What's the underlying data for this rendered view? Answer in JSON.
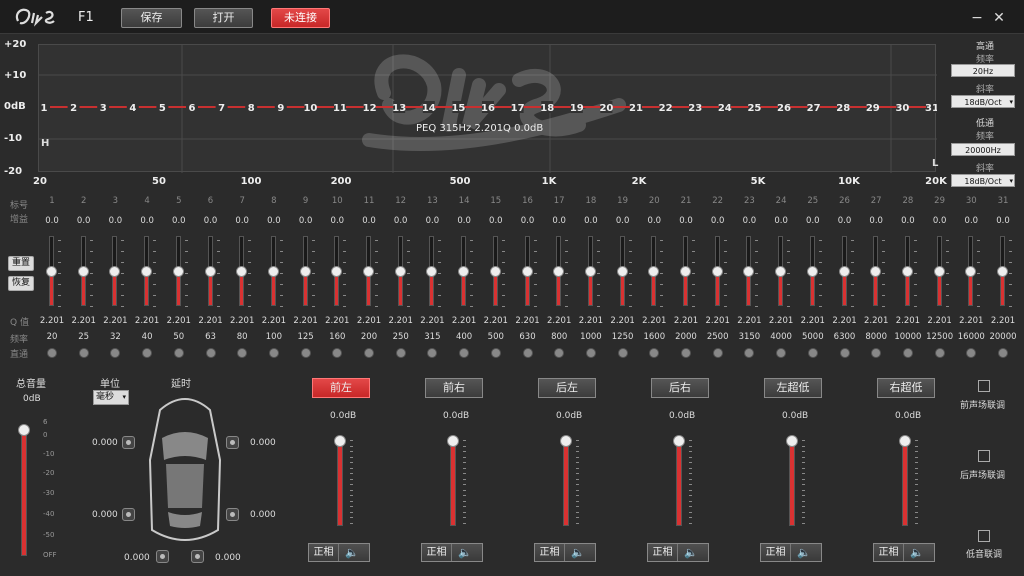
{
  "header": {
    "model": "F1",
    "save": "保存",
    "open": "打开",
    "status": "未连接",
    "minimize": "−",
    "close": "✕"
  },
  "graph": {
    "y_labels": [
      "+20",
      "+10",
      "0dB",
      "-10",
      "-20"
    ],
    "x_labels": [
      "20",
      "50",
      "100",
      "200",
      "500",
      "1K",
      "2K",
      "5K",
      "10K",
      "20K"
    ],
    "peq_text": "PEQ 315Hz 2.201Q 0.0dB",
    "hp_marker": "H",
    "lp_marker": "L",
    "points": [
      "1",
      "2",
      "3",
      "4",
      "5",
      "6",
      "7",
      "8",
      "9",
      "10",
      "11",
      "12",
      "13",
      "14",
      "15",
      "16",
      "17",
      "18",
      "19",
      "20",
      "21",
      "22",
      "23",
      "24",
      "25",
      "26",
      "27",
      "28",
      "29",
      "30",
      "31"
    ]
  },
  "filter_panel": {
    "hp_title": "高通",
    "hp_freq_label": "频率",
    "hp_freq": "20Hz",
    "hp_slope_label": "斜率",
    "hp_slope": "18dB/Oct",
    "lp_title": "低通",
    "lp_freq_label": "频率",
    "lp_freq": "20000Hz",
    "lp_slope_label": "斜率",
    "lp_slope": "18dB/Oct"
  },
  "eq": {
    "row_labels": {
      "index": "标号",
      "gain": "增益",
      "q": "Q 值",
      "freq": "频率",
      "bypass": "直通"
    },
    "reset": "重置",
    "restore": "恢复",
    "bands": [
      {
        "n": "1",
        "g": "0.0",
        "q": "2.201",
        "f": "20"
      },
      {
        "n": "2",
        "g": "0.0",
        "q": "2.201",
        "f": "25"
      },
      {
        "n": "3",
        "g": "0.0",
        "q": "2.201",
        "f": "32"
      },
      {
        "n": "4",
        "g": "0.0",
        "q": "2.201",
        "f": "40"
      },
      {
        "n": "5",
        "g": "0.0",
        "q": "2.201",
        "f": "50"
      },
      {
        "n": "6",
        "g": "0.0",
        "q": "2.201",
        "f": "63"
      },
      {
        "n": "7",
        "g": "0.0",
        "q": "2.201",
        "f": "80"
      },
      {
        "n": "8",
        "g": "0.0",
        "q": "2.201",
        "f": "100"
      },
      {
        "n": "9",
        "g": "0.0",
        "q": "2.201",
        "f": "125"
      },
      {
        "n": "10",
        "g": "0.0",
        "q": "2.201",
        "f": "160"
      },
      {
        "n": "11",
        "g": "0.0",
        "q": "2.201",
        "f": "200"
      },
      {
        "n": "12",
        "g": "0.0",
        "q": "2.201",
        "f": "250"
      },
      {
        "n": "13",
        "g": "0.0",
        "q": "2.201",
        "f": "315"
      },
      {
        "n": "14",
        "g": "0.0",
        "q": "2.201",
        "f": "400"
      },
      {
        "n": "15",
        "g": "0.0",
        "q": "2.201",
        "f": "500"
      },
      {
        "n": "16",
        "g": "0.0",
        "q": "2.201",
        "f": "630"
      },
      {
        "n": "17",
        "g": "0.0",
        "q": "2.201",
        "f": "800"
      },
      {
        "n": "18",
        "g": "0.0",
        "q": "2.201",
        "f": "1000"
      },
      {
        "n": "19",
        "g": "0.0",
        "q": "2.201",
        "f": "1250"
      },
      {
        "n": "20",
        "g": "0.0",
        "q": "2.201",
        "f": "1600"
      },
      {
        "n": "21",
        "g": "0.0",
        "q": "2.201",
        "f": "2000"
      },
      {
        "n": "22",
        "g": "0.0",
        "q": "2.201",
        "f": "2500"
      },
      {
        "n": "23",
        "g": "0.0",
        "q": "2.201",
        "f": "3150"
      },
      {
        "n": "24",
        "g": "0.0",
        "q": "2.201",
        "f": "4000"
      },
      {
        "n": "25",
        "g": "0.0",
        "q": "2.201",
        "f": "5000"
      },
      {
        "n": "26",
        "g": "0.0",
        "q": "2.201",
        "f": "6300"
      },
      {
        "n": "27",
        "g": "0.0",
        "q": "2.201",
        "f": "8000"
      },
      {
        "n": "28",
        "g": "0.0",
        "q": "2.201",
        "f": "10000"
      },
      {
        "n": "29",
        "g": "0.0",
        "q": "2.201",
        "f": "12500"
      },
      {
        "n": "30",
        "g": "0.0",
        "q": "2.201",
        "f": "16000"
      },
      {
        "n": "31",
        "g": "0.0",
        "q": "2.201",
        "f": "20000"
      }
    ]
  },
  "master": {
    "label": "总音量",
    "value": "0dB",
    "scale": [
      "6",
      "0",
      "-10",
      "-20",
      "-30",
      "-40",
      "-50",
      "OFF"
    ]
  },
  "delay": {
    "unit_label": "单位",
    "unit_value": "毫秒",
    "delay_label": "延时",
    "fl": "0.000",
    "fr": "0.000",
    "rl": "0.000",
    "rr": "0.000",
    "sl": "0.000",
    "sr": "0.000"
  },
  "channels": [
    {
      "name": "前左",
      "value": "0.0dB",
      "phase": "正相",
      "active": true
    },
    {
      "name": "前右",
      "value": "0.0dB",
      "phase": "正相",
      "active": false
    },
    {
      "name": "后左",
      "value": "0.0dB",
      "phase": "正相",
      "active": false
    },
    {
      "name": "后右",
      "value": "0.0dB",
      "phase": "正相",
      "active": false
    },
    {
      "name": "左超低",
      "value": "0.0dB",
      "phase": "正相",
      "active": false
    },
    {
      "name": "右超低",
      "value": "0.0dB",
      "phase": "正相",
      "active": false
    }
  ],
  "links": {
    "front": "前声场联调",
    "rear": "后声场联调",
    "sub": "低音联调"
  },
  "colors": {
    "accent": "#d93232",
    "curve": "#c83030"
  }
}
